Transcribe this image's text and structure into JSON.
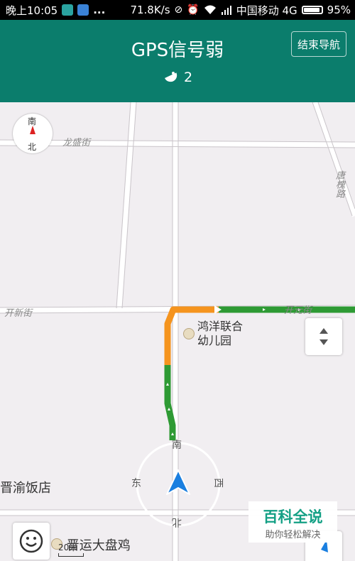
{
  "status_bar": {
    "time": "晚上10:05",
    "dots": "...",
    "speed": "71.8K/s",
    "carrier": "中国移动 4G",
    "battery": "95%",
    "battery_level": 0.95
  },
  "header": {
    "title": "GPS信号弱",
    "satellite_count": "2",
    "end_button_label": "结束导航",
    "background_color": "#0b7d6c"
  },
  "map": {
    "compass": {
      "top": "南",
      "bottom": "北"
    },
    "streets": [
      {
        "id": "longsheng",
        "label": "龙盛街"
      },
      {
        "id": "tangjing",
        "label": "唐槐路"
      },
      {
        "id": "kaixin",
        "label": "开新街"
      },
      {
        "id": "kaiyuan",
        "label": "开元街"
      }
    ],
    "pois": [
      {
        "name_line1": "鸿洋联合",
        "name_line2": "幼儿园"
      },
      {
        "name": "晋渝饭店"
      },
      {
        "name": "晋运大盘鸡"
      }
    ],
    "directions": {
      "north": "北",
      "south": "南",
      "east": "东",
      "west": "西"
    },
    "scale_label": "20米",
    "route_colors": {
      "smooth": "#2e9a34",
      "slow": "#f5941e"
    },
    "icons": [
      "satellite-icon",
      "compass-icon",
      "zoom-toggle-icon",
      "navigation-arrow-icon",
      "emoji-icon",
      "poi-icon"
    ]
  },
  "watermark": {
    "title": "百科全说",
    "subtitle": "助你轻松解决"
  }
}
